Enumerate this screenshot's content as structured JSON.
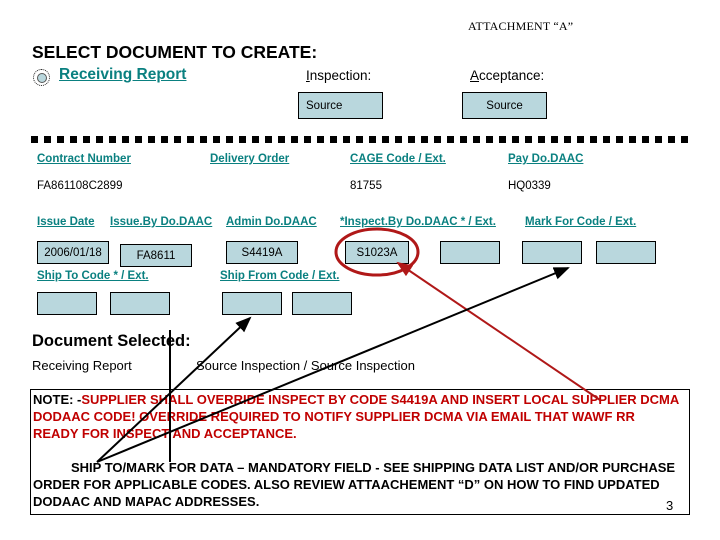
{
  "header": {
    "attachment_label": "ATTACHMENT “A”",
    "select_document_title": "SELECT DOCUMENT TO CREATE:"
  },
  "document_type": {
    "radio_label": "Receiving Report",
    "radio_selected": true,
    "link_color": "#0a8080"
  },
  "inspection": {
    "caption_accel": "I",
    "caption_rest": "nspection:",
    "value": "Source"
  },
  "acceptance": {
    "caption_accel": "A",
    "caption_rest": "cceptance:",
    "value": "Source"
  },
  "form": {
    "row1": {
      "labels": {
        "contract_number": "Contract Number",
        "delivery_order": "Delivery Order",
        "cage_code": "CAGE Code / Ext.",
        "pay_dodaac": "Pay Do.DAAC"
      },
      "values": {
        "contract_number": "FA861108C2899",
        "delivery_order": "",
        "cage_code": "81755",
        "pay_dodaac": "HQ0339"
      }
    },
    "row2": {
      "labels": {
        "issue_date": "Issue Date",
        "issueby_dodaac": "Issue.By Do.DAAC",
        "admin_dodaac": "Admin Do.DAAC",
        "inspectby_dodaac": "*Inspect.By Do.DAAC * / Ext.",
        "markfor_code": "Mark For Code / Ext."
      },
      "values": {
        "issue_date": "2006/01/18",
        "issueby_dodaac": "FA8611",
        "admin_dodaac": "S4419A",
        "inspectby_dodaac": "S1023A",
        "inspect_ext": "",
        "markfor_code": "",
        "markfor_ext": ""
      }
    },
    "row3": {
      "labels": {
        "shipto_code": "Ship To Code * / Ext.",
        "shipfrom_code": "Ship From Code / Ext."
      },
      "values": {
        "shipto_code": "",
        "shipto_ext": "",
        "shipfrom_code": "",
        "shipfrom_ext": ""
      }
    },
    "field_fill_color": "#b9d7dd"
  },
  "document_selected": {
    "title": "Document Selected:",
    "type": "Receiving Report",
    "inspection_acceptance": "Source Inspection / Source Inspection"
  },
  "note": {
    "prefix": "NOTE: -",
    "text": "SUPPLIER SHALL OVERRIDE INSPECT BY CODE S4419A AND INSERT LOCAL SUPPLIER DCMA DODAAC CODE!  OVERRIDE REQUIRED TO NOTIFY SUPPLIER DCMA VIA EMAIL THAT WAWF RR READY FOR INSPECT AND ACCEPTANCE.",
    "color": "#c00000",
    "ship_text": "SHIP TO/MARK FOR DATA – MANDATORY FIELD - SEE SHIPPING DATA LIST AND/OR PURCHASE ORDER FOR APPLICABLE CODES. ALSO REVIEW ATTAACHEMENT “D” ON HOW TO FIND UPDATED DODAAC AND MAPAC ADDRESSES."
  },
  "page_number": "3"
}
